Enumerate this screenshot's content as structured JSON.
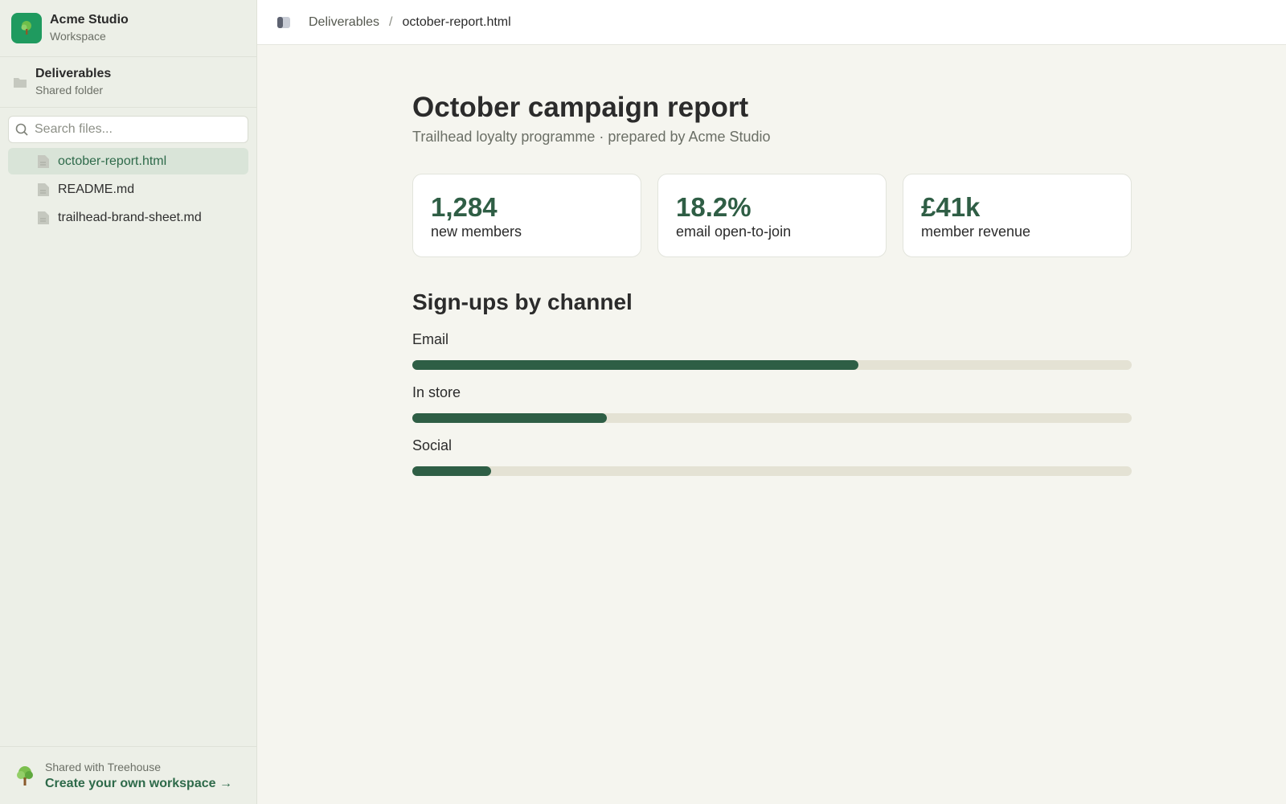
{
  "workspace": {
    "name": "Acme Studio",
    "subtitle": "Workspace",
    "accent": "#1f9a5f"
  },
  "folder": {
    "name": "Deliverables",
    "subtitle": "Shared folder",
    "icon": "folder-icon"
  },
  "search": {
    "placeholder": "Search files...",
    "value": ""
  },
  "files": [
    {
      "label": "october-report.html",
      "active": true,
      "icon": "file-icon"
    },
    {
      "label": "README.md",
      "active": false,
      "icon": "file-icon"
    },
    {
      "label": "trailhead-brand-sheet.md",
      "active": false,
      "icon": "file-icon"
    }
  ],
  "footer": {
    "shared_text": "Shared with Treehouse",
    "link_text": "Create your own workspace →",
    "icon": "tree-icon"
  },
  "breadcrumb": {
    "parent": "Deliverables",
    "separator": "/",
    "current": "october-report.html"
  },
  "report": {
    "title": "October campaign report",
    "subtitle": "Trailhead loyalty programme · prepared by Acme Studio",
    "kpis": [
      {
        "value": "1,284",
        "label": "new members"
      },
      {
        "value": "18.2%",
        "label": "email open-to-join"
      },
      {
        "value": "£41k",
        "label": "member revenue"
      }
    ],
    "section_title": "Sign-ups by channel",
    "channels": [
      {
        "name": "Email",
        "fraction": 0.62
      },
      {
        "name": "In store",
        "fraction": 0.27
      },
      {
        "name": "Social",
        "fraction": 0.11
      }
    ],
    "bar_color": "#2e5e45",
    "track_color": "#e4e2d4"
  }
}
